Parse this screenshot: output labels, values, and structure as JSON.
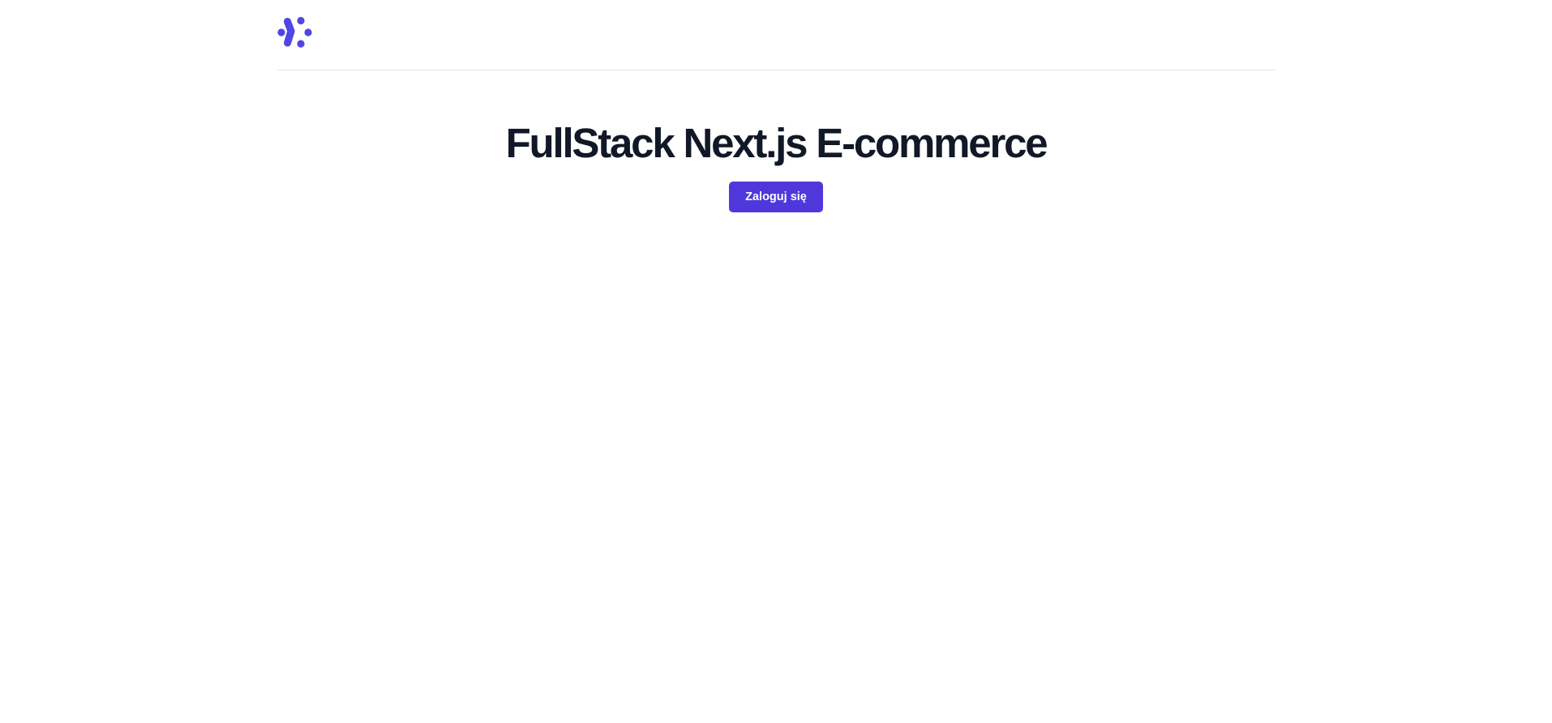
{
  "header": {
    "logo_icon": "brand-dots-chevron-icon",
    "logo_color": "#4f46e5"
  },
  "main": {
    "title": "FullStack Next.js E-commerce",
    "login_button_label": "Zaloguj się",
    "button_color": "#4f37dc",
    "title_color": "#111827"
  }
}
